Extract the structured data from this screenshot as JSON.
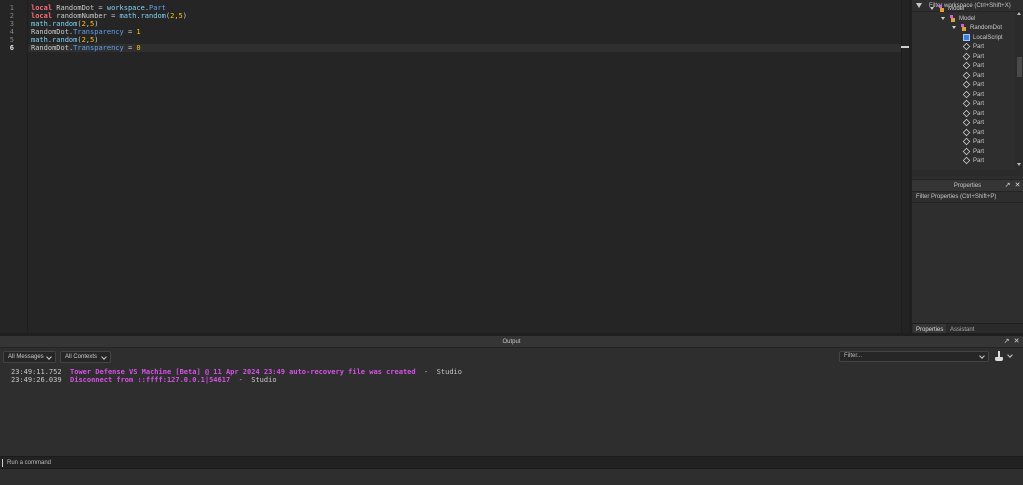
{
  "editor": {
    "line_numbers": [
      "1",
      "2",
      "3",
      "4",
      "5",
      "6"
    ],
    "lines": [
      [
        {
          "t": "local",
          "c": "kw"
        },
        {
          "t": " RandomDot = ",
          "c": ""
        },
        {
          "t": "workspace",
          "c": "gl"
        },
        {
          "t": ".",
          "c": ""
        },
        {
          "t": "Part",
          "c": "pr"
        }
      ],
      [
        {
          "t": "local",
          "c": "kw"
        },
        {
          "t": " randomNumber = ",
          "c": ""
        },
        {
          "t": "math.random",
          "c": "gl"
        },
        {
          "t": "(",
          "c": ""
        },
        {
          "t": "2",
          "c": "num"
        },
        {
          "t": ",",
          "c": ""
        },
        {
          "t": "5",
          "c": "num"
        },
        {
          "t": ")",
          "c": ""
        }
      ],
      [
        {
          "t": "math.random",
          "c": "gl"
        },
        {
          "t": "(",
          "c": ""
        },
        {
          "t": "2",
          "c": "num"
        },
        {
          "t": ",",
          "c": ""
        },
        {
          "t": "5",
          "c": "num"
        },
        {
          "t": ")",
          "c": ""
        }
      ],
      [
        {
          "t": "RandomDot",
          "c": ""
        },
        {
          "t": ".",
          "c": ""
        },
        {
          "t": "Transparency",
          "c": "pr"
        },
        {
          "t": " = ",
          "c": ""
        },
        {
          "t": "1",
          "c": "num"
        }
      ],
      [
        {
          "t": "math.random",
          "c": "gl"
        },
        {
          "t": "(",
          "c": ""
        },
        {
          "t": "2",
          "c": "num"
        },
        {
          "t": ",",
          "c": ""
        },
        {
          "t": "5",
          "c": "num"
        },
        {
          "t": ")",
          "c": ""
        }
      ],
      [
        {
          "t": "RandomDot",
          "c": ""
        },
        {
          "t": ".",
          "c": ""
        },
        {
          "t": "Transparency",
          "c": "pr"
        },
        {
          "t": " = ",
          "c": ""
        },
        {
          "t": "0",
          "c": "num"
        }
      ]
    ],
    "current_line": 6
  },
  "explorer": {
    "filter_placeholder": "Filter workspace (Ctrl+Shift+X)",
    "items": [
      {
        "label": "Model",
        "icon": "model-icon",
        "depth": 2,
        "expanded": true
      },
      {
        "label": "Model",
        "icon": "model-icon",
        "depth": 3,
        "expanded": true
      },
      {
        "label": "RandomDot",
        "icon": "model-icon",
        "depth": 4,
        "expanded": true
      },
      {
        "label": "LocalScript",
        "icon": "script-icon",
        "depth": 5
      },
      {
        "label": "Part",
        "icon": "part-icon",
        "depth": 5
      },
      {
        "label": "Part",
        "icon": "part-icon",
        "depth": 5
      },
      {
        "label": "Part",
        "icon": "part-icon",
        "depth": 5
      },
      {
        "label": "Part",
        "icon": "part-icon",
        "depth": 5
      },
      {
        "label": "Part",
        "icon": "part-icon",
        "depth": 5
      },
      {
        "label": "Part",
        "icon": "part-icon",
        "depth": 5
      },
      {
        "label": "Part",
        "icon": "part-icon",
        "depth": 5
      },
      {
        "label": "Part",
        "icon": "part-icon",
        "depth": 5
      },
      {
        "label": "Part",
        "icon": "part-icon",
        "depth": 5
      },
      {
        "label": "Part",
        "icon": "part-icon",
        "depth": 5
      },
      {
        "label": "Part",
        "icon": "part-icon",
        "depth": 5
      },
      {
        "label": "Part",
        "icon": "part-icon",
        "depth": 5
      },
      {
        "label": "Part",
        "icon": "part-icon",
        "depth": 5
      }
    ]
  },
  "properties": {
    "title": "Properties",
    "filter_placeholder": "Filter Properties (Ctrl+Shift+P)",
    "tabs": [
      {
        "label": "Properties",
        "active": true
      },
      {
        "label": "Assistant",
        "active": false
      }
    ]
  },
  "output": {
    "title": "Output",
    "messages_filter": "All Messages",
    "contexts_filter": "All Contexts",
    "filter_placeholder": "Filter...",
    "entries": [
      {
        "time": "23:49:11.752",
        "message": "Tower Defense VS Machine [Beta] @ 11 Apr 2024 23:49 auto-recovery file was created",
        "source": "Studio"
      },
      {
        "time": "23:49:26.039",
        "message": "Disconnect from ::ffff:127.0.0.1|54617",
        "source": "Studio"
      }
    ]
  },
  "command_bar": {
    "placeholder": "Run a command"
  },
  "icons": {
    "float": "↗",
    "close": "✕"
  },
  "colors": {
    "background": "#2e2e2e",
    "editor_bg": "#252525",
    "keyword": "#f86d7c",
    "builtin": "#84d6f7",
    "number": "#ffc600",
    "property": "#61a1f1",
    "log_message": "#d652e6"
  }
}
